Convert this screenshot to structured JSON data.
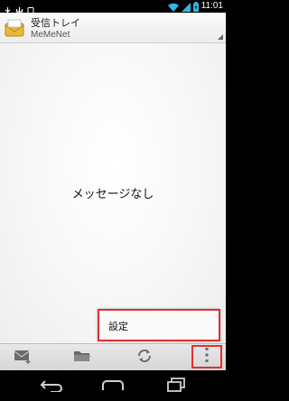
{
  "status_bar": {
    "time": "11:01",
    "icons": [
      "usb-icon",
      "usb-debug-icon",
      "phone-icon",
      "wifi-icon",
      "signal-icon",
      "battery-icon"
    ]
  },
  "action_bar": {
    "title": "受信トレイ",
    "subtitle": "MeMeNet",
    "app_icon": "mail-envelope-icon"
  },
  "content": {
    "empty_message": "メッセージなし"
  },
  "overflow_menu": {
    "items": [
      {
        "label": "設定"
      }
    ]
  },
  "bottom_bar": {
    "buttons": [
      "compose-mail-icon",
      "folder-icon",
      "refresh-icon",
      "overflow-menu-icon"
    ]
  },
  "nav_bar": {
    "buttons": [
      "back-icon",
      "home-icon",
      "recent-apps-icon"
    ]
  },
  "colors": {
    "highlight": "#e03030",
    "wifi_signal": "#33b5e5",
    "battery": "#33b5e5"
  }
}
